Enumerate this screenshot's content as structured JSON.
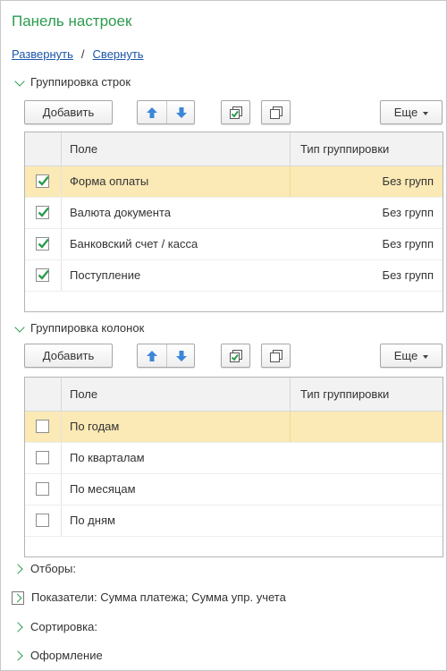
{
  "panel": {
    "title": "Панель настроек",
    "expand_label": "Развернуть",
    "separator": "/",
    "collapse_label": "Свернуть"
  },
  "row_grouping": {
    "header": "Группировка строк",
    "add_label": "Добавить",
    "more_label": "Еще",
    "columns": {
      "field": "Поле",
      "type": "Тип группировки"
    },
    "rows": [
      {
        "name": "Форма оплаты",
        "type": "Без групп",
        "checked": true,
        "selected": true
      },
      {
        "name": "Валюта документа",
        "type": "Без групп",
        "checked": true,
        "selected": false
      },
      {
        "name": "Банковский счет / касса",
        "type": "Без групп",
        "checked": true,
        "selected": false
      },
      {
        "name": "Поступление",
        "type": "Без групп",
        "checked": true,
        "selected": false
      }
    ]
  },
  "column_grouping": {
    "header": "Группировка колонок",
    "add_label": "Добавить",
    "more_label": "Еще",
    "columns": {
      "field": "Поле",
      "type": "Тип группировки"
    },
    "rows": [
      {
        "name": "По годам",
        "type": "",
        "checked": false,
        "selected": true
      },
      {
        "name": "По кварталам",
        "type": "",
        "checked": false,
        "selected": false
      },
      {
        "name": "По месяцам",
        "type": "",
        "checked": false,
        "selected": false
      },
      {
        "name": "По дням",
        "type": "",
        "checked": false,
        "selected": false
      }
    ]
  },
  "collapsed_sections": {
    "filters": "Отборы:",
    "indicators": "Показатели: Сумма платежа; Сумма упр. учета",
    "sorting": "Сортировка:",
    "appearance": "Оформление"
  },
  "icons": {
    "move_up": "arrow-up-icon",
    "move_down": "arrow-down-icon",
    "check_all": "check-all-icon",
    "uncheck_all": "uncheck-all-icon"
  },
  "colors": {
    "accent_green": "#2c9c4e",
    "link_blue": "#1b56a8",
    "selected_row": "#fbe9b6",
    "arrow_blue": "#3b86d8"
  }
}
